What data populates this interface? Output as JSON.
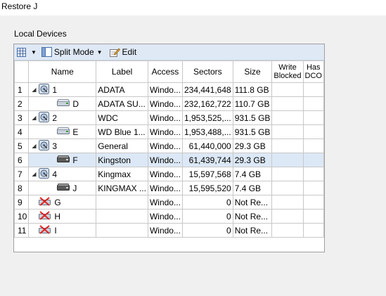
{
  "window": {
    "title": "Restore J"
  },
  "group_label": "Local Devices",
  "toolbar": {
    "split_mode_label": "Split Mode",
    "edit_label": "Edit"
  },
  "columns": {
    "name": "Name",
    "label": "Label",
    "access": "Access",
    "sectors": "Sectors",
    "size": "Size",
    "write_blocked": [
      "Write",
      "Blocked"
    ],
    "has_dco": [
      "Has",
      "DCO"
    ]
  },
  "rows": [
    {
      "num": "1",
      "name": "1",
      "label": "ADATA",
      "access": "Windo...",
      "sectors": "234,441,648",
      "size": "111.8 GB",
      "kind": "disk",
      "indent": 0,
      "expanded": true
    },
    {
      "num": "2",
      "name": "D",
      "label": "ADATA SU...",
      "access": "Windo...",
      "sectors": "232,162,722",
      "size": "110.7 GB",
      "kind": "volume",
      "indent": 1
    },
    {
      "num": "3",
      "name": "2",
      "label": "WDC",
      "access": "Windo...",
      "sectors": "1,953,525,...",
      "size": "931.5 GB",
      "kind": "disk",
      "indent": 0,
      "expanded": true
    },
    {
      "num": "4",
      "name": "E",
      "label": "WD Blue 1...",
      "access": "Windo...",
      "sectors": "1,953,488,...",
      "size": "931.5 GB",
      "kind": "volume",
      "indent": 1
    },
    {
      "num": "5",
      "name": "3",
      "label": "General",
      "access": "Windo...",
      "sectors": "61,440,000",
      "size": "29.3 GB",
      "kind": "disk",
      "indent": 0,
      "expanded": true
    },
    {
      "num": "6",
      "name": "F",
      "label": "Kingston",
      "access": "Windo...",
      "sectors": "61,439,744",
      "size": "29.3 GB",
      "kind": "removable",
      "indent": 1,
      "selected": true
    },
    {
      "num": "7",
      "name": "4",
      "label": "Kingmax",
      "access": "Windo...",
      "sectors": "15,597,568",
      "size": "7.4 GB",
      "kind": "disk",
      "indent": 0,
      "expanded": true
    },
    {
      "num": "8",
      "name": "J",
      "label": "KINGMAX ...",
      "access": "Windo...",
      "sectors": "15,595,520",
      "size": "7.4 GB",
      "kind": "removable",
      "indent": 1
    },
    {
      "num": "9",
      "name": "G",
      "label": "",
      "access": "Windo...",
      "sectors": "0",
      "size": "Not Re...",
      "kind": "unavailable",
      "indent": 0
    },
    {
      "num": "10",
      "name": "H",
      "label": "",
      "access": "Windo...",
      "sectors": "0",
      "size": "Not Re...",
      "kind": "unavailable",
      "indent": 0
    },
    {
      "num": "11",
      "name": "I",
      "label": "",
      "access": "Windo...",
      "sectors": "0",
      "size": "Not Re...",
      "kind": "unavailable",
      "indent": 0
    }
  ],
  "icons": {
    "grid": "grid-view-icon",
    "split": "split-mode-icon",
    "edit": "edit-icon",
    "disk": "hard-disk-icon",
    "volume": "volume-icon",
    "removable": "removable-drive-icon",
    "unavailable": "unavailable-drive-icon",
    "expand": "expanded-arrow-icon"
  }
}
